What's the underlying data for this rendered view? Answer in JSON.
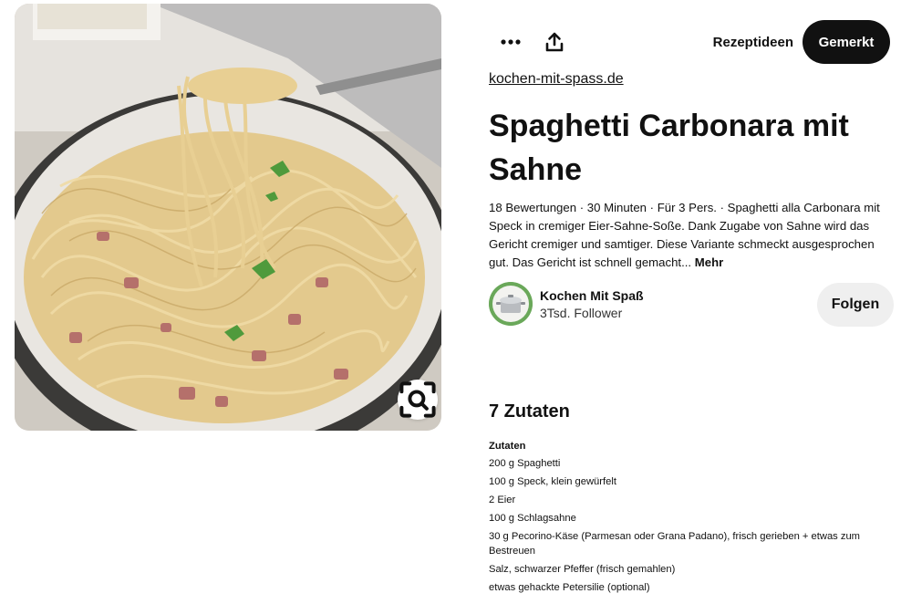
{
  "toolbar": {
    "more_icon": "more-dots-icon",
    "share_icon": "share-upload-icon",
    "board_label": "Rezeptideen",
    "saved_label": "Gemerkt"
  },
  "image": {
    "alt": "Spaghetti Carbonara",
    "lens_icon": "visual-search-icon"
  },
  "pin": {
    "source": "kochen-mit-spass.de",
    "title": "Spaghetti Carbonara mit Sahne",
    "description": "18 Bewertungen · 30 Minuten · Für 3 Pers. · Spaghetti alla Carbonara mit Speck in cremiger Eier-Sahne-Soße. Dank Zugabe von Sahne wird das Gericht cremiger und samtiger. Diese Variante schmeckt ausgesprochen gut. Das Gericht ist schnell gemacht...",
    "more_label": "Mehr"
  },
  "creator": {
    "name": "Kochen Mit Spaß",
    "followers": "3Tsd. Follower",
    "follow_label": "Folgen"
  },
  "ingredients": {
    "heading": "7 Zutaten",
    "sub_heading": "Zutaten",
    "items": [
      "200 g Spaghetti",
      "100 g Speck, klein gewürfelt",
      "2 Eier",
      "100 g Schlagsahne",
      "30 g Pecorino-Käse (Parmesan oder Grana Padano), frisch gerieben + etwas zum Bestreuen",
      "Salz, schwarzer Pfeffer (frisch gemahlen)",
      "etwas gehackte Petersilie (optional)"
    ]
  },
  "colors": {
    "primary_button": "#111111",
    "secondary_button": "#efefef",
    "text": "#111111"
  }
}
